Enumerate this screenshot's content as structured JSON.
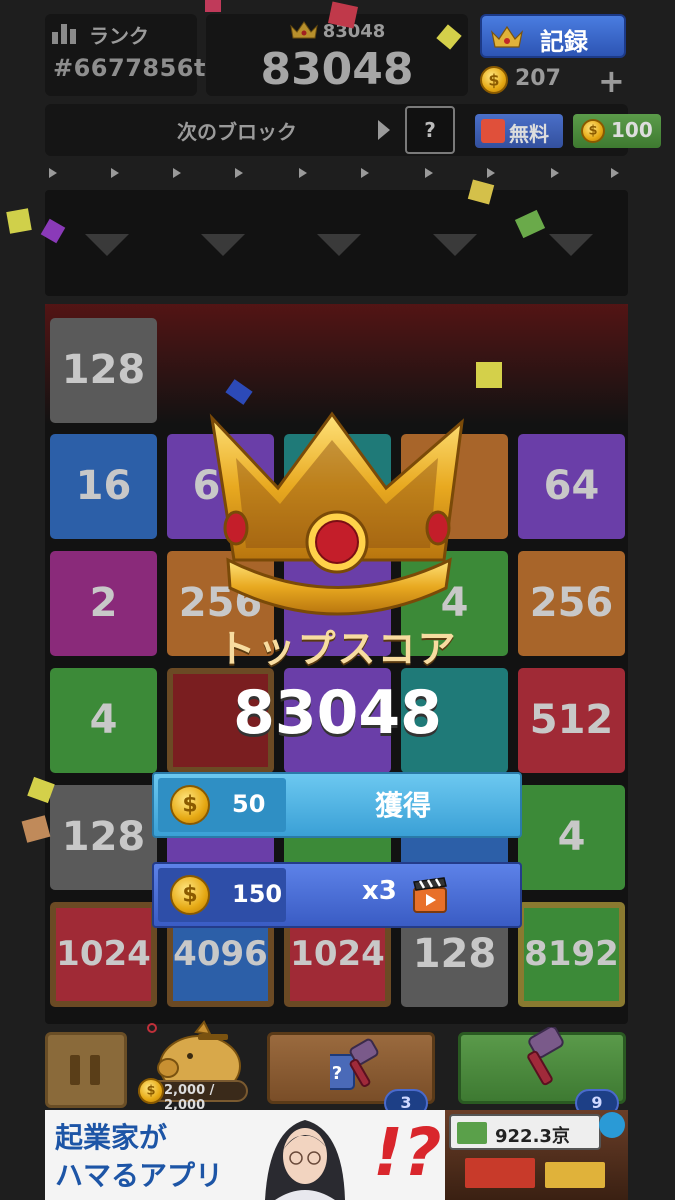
{
  "header": {
    "rank_label": "ランク",
    "rank_value": "#6677856t",
    "best_score": "83048",
    "current_score": "83048",
    "record_label": "記録",
    "coins": "207",
    "plus": "+"
  },
  "next_block": {
    "label": "次のブロック",
    "preview": "?",
    "free_label": "無料",
    "coin_cost": "100"
  },
  "board": {
    "tiles": [
      "128",
      "16",
      "64",
      "64",
      "2",
      "256",
      "256",
      "4",
      "512",
      "128",
      "4",
      "1024",
      "4096",
      "1024",
      "128",
      "8192"
    ],
    "tile_colors": {
      "grey": "#5a5a5a",
      "blue": "#2c5fa8",
      "purple": "#6a3ea8",
      "magenta": "#8a2a7a",
      "orange": "#a8652a",
      "green": "#3c8a38",
      "teal": "#1f7a78",
      "red": "#a02a36",
      "darkred": "#7a1e20"
    }
  },
  "top_score": {
    "title": "トップスコア",
    "score": "83048",
    "reward1_amount": "50",
    "reward1_action": "獲得",
    "reward2_amount": "150",
    "reward2_action": "x3"
  },
  "tools": {
    "piggy_progress": "2,000 / 2,000",
    "tool1_count": "3",
    "tool2_count": "9"
  },
  "ad": {
    "line1": "起業家が",
    "line2": "ハマるアプリ",
    "mark": "!?",
    "money": "922.3京"
  }
}
